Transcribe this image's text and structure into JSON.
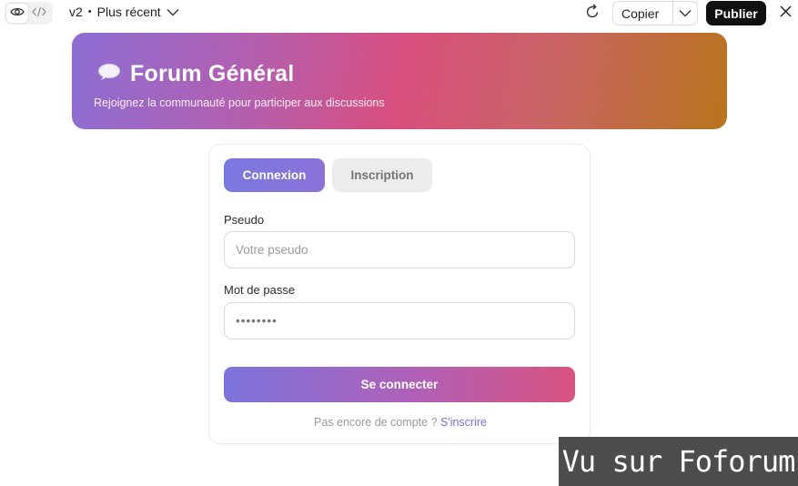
{
  "toolbar": {
    "version": "v2",
    "version_sep": "•",
    "version_label": "Plus récent",
    "copy_label": "Copier",
    "publish_label": "Publier"
  },
  "hero": {
    "emoji": "💬",
    "title": "Forum Général",
    "subtitle": "Rejoignez la communauté pour participer aux discussions"
  },
  "auth": {
    "tabs": {
      "login": "Connexion",
      "register": "Inscription",
      "active": "login"
    },
    "pseudo_label": "Pseudo",
    "pseudo_placeholder": "Votre pseudo",
    "password_label": "Mot de passe",
    "password_value": "••••••••",
    "submit_label": "Se connecter",
    "footer_text": "Pas encore de compte ?",
    "footer_link": "S'inscrire"
  },
  "watermark": "Vu sur Foforum",
  "colors": {
    "accent": "#7a6ed6",
    "banner_start": "#8c6ed4",
    "banner_mid": "#d84f7e",
    "banner_end": "#b8741c",
    "publish_bg": "#111111"
  },
  "icons": [
    "eye-icon",
    "code-icon",
    "chevron-down-icon",
    "refresh-icon",
    "close-icon",
    "speech-bubble-icon"
  ]
}
